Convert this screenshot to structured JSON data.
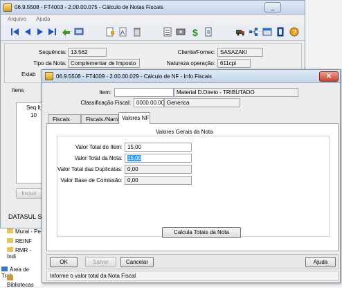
{
  "outer": {
    "title": "06.9.5508 - FT4003 - 2.00.00.075 - Cálculo de Notas Fiscais",
    "menu": [
      "Arquivo",
      "Ajuda"
    ],
    "labels": {
      "sequencia": "Sequência:",
      "tipo_nota": "Tipo da Nota:",
      "estab": "Estab",
      "cliente": "Cliente/Fornec:",
      "natureza": "Natureza operação:"
    },
    "values": {
      "sequencia": "13.562",
      "tipo_nota": "Complementar de Imposto",
      "cliente": "SASAZAKI",
      "natureza": "611cpl"
    },
    "itens_label": "Itens",
    "grid_header": "Seq It",
    "grid_row": "10",
    "incluir": "Incluir",
    "datasul": "DATASUL S"
  },
  "explorer": {
    "items": [
      "Mural - Pe",
      "REINF",
      "RMR - Indi"
    ],
    "area": "Área de Trab",
    "biblioteca": "Bibliotecas"
  },
  "dialog": {
    "title": "06.9.5508 - FT4009 - 2.00.00.029 - Cálculo de NF - Info Fiscais",
    "item_label": "Item:",
    "item_desc": "Material D.Direto - TRIBUTADO",
    "class_label": "Classificação Fiscal:",
    "class_value": "0000.00.00",
    "class_desc": "Generica",
    "tabs": [
      "Fiscais",
      "Fiscais./Narra",
      "Valores NF"
    ],
    "group_title": "Valores Gerais da Nota",
    "fields": [
      {
        "label": "Valor Total do Item:",
        "value": "15,00"
      },
      {
        "label": "Valor Total da Nota:",
        "value": "15,00"
      },
      {
        "label": "Valor Total das Duplicatas:",
        "value": "0,00"
      },
      {
        "label": "Valor Base de Comissão:",
        "value": "0,00"
      }
    ],
    "calc_button": "Calcula Totais da Nota",
    "ok": "OK",
    "salvar": "Salvar",
    "cancelar": "Cancelar",
    "ajuda": "Ajuda",
    "status": "Informe o valor total da Nota Fiscal"
  }
}
